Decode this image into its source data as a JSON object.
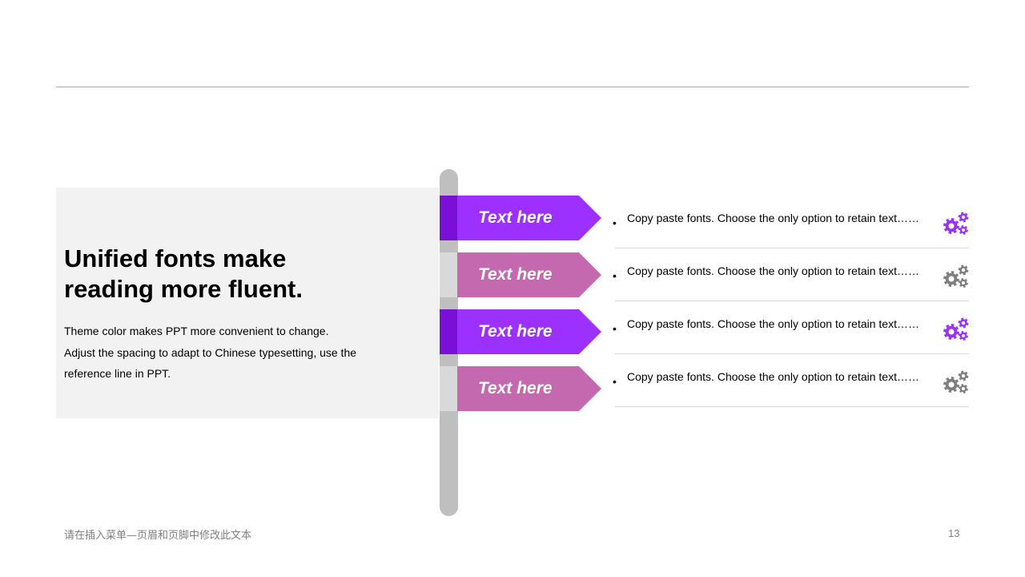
{
  "panel": {
    "title_line1": "Unified fonts make",
    "title_line2": "reading more fluent.",
    "body_line1": "Theme color makes PPT more convenient  to change.",
    "body_line2": "Adjust  the  spacing  to adapt to Chinese typesetting,  use  the",
    "body_line3": "reference  line  in  PPT."
  },
  "colors": {
    "purple": "#9b30ff",
    "purple_dark": "#7a10d8",
    "pink": "#c468b0",
    "pole": "#bfbfbf",
    "gear_purple": "#9b30ff",
    "gear_gray": "#7f7f7f"
  },
  "signs": [
    {
      "label": "Text here",
      "style": "purple",
      "gear": "gear-purple-icon"
    },
    {
      "label": "Text here",
      "style": "pink",
      "gear": "gear-gray-icon"
    },
    {
      "label": "Text here",
      "style": "purple",
      "gear": "gear-purple-icon"
    },
    {
      "label": "Text here",
      "style": "pink",
      "gear": "gear-gray-icon"
    }
  ],
  "items": [
    {
      "text": "Copy paste fonts. Choose the only  option to retain  text……"
    },
    {
      "text": "Copy paste fonts. Choose the only  option to retain  text……"
    },
    {
      "text": "Copy paste fonts. Choose the only  option to retain  text……"
    },
    {
      "text": "Copy paste fonts. Choose the only  option to retain  text……"
    }
  ],
  "footer": {
    "text": "请在插入菜单—页眉和页脚中修改此文本",
    "page_number": "13"
  }
}
